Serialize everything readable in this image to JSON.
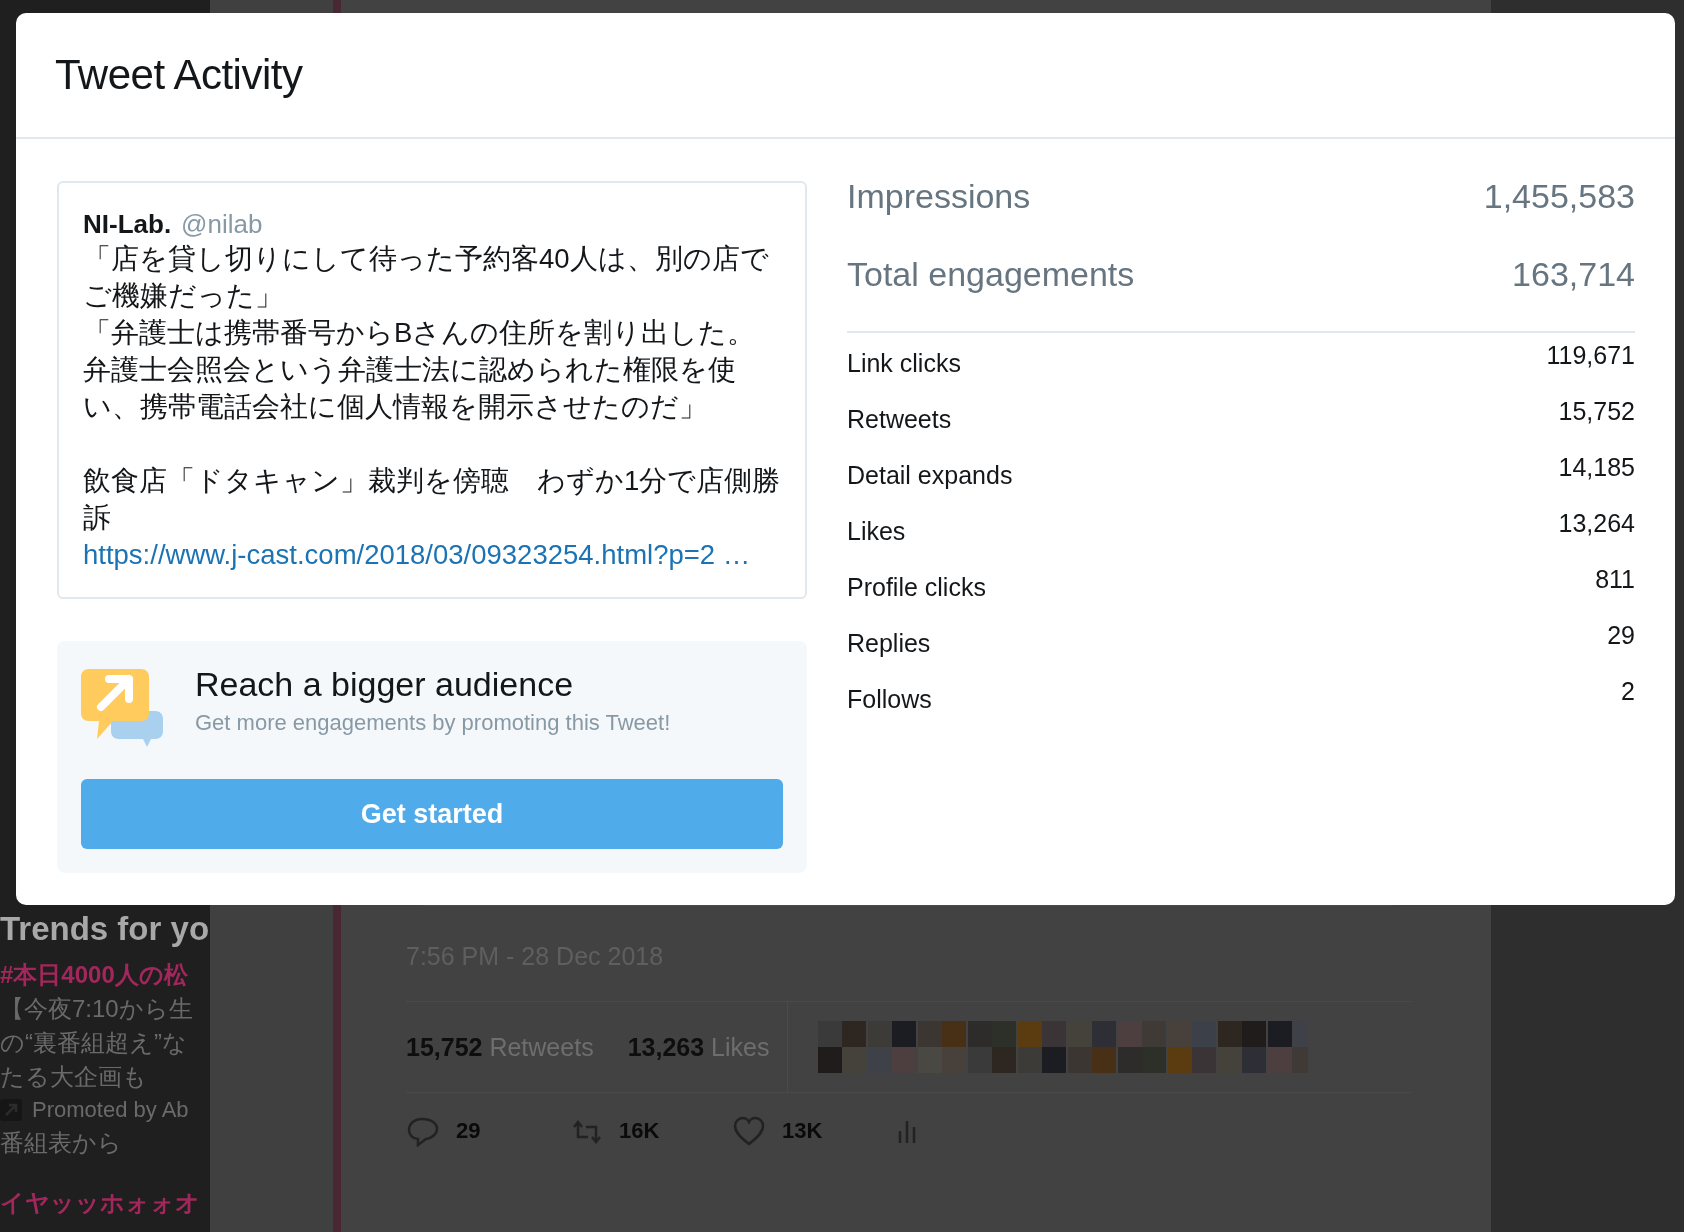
{
  "background": {
    "sidebar": {
      "trends_title": "Trends for yo",
      "trends": [
        {
          "name": "#本日4000人の松",
          "lines": [
            "【今夜7:10から生",
            "の“裏番組超え”な",
            "たる大企画も"
          ],
          "promoted": "Promoted by Ab",
          "note": "番組表から"
        },
        {
          "name": "イヤッッホォォオ"
        }
      ]
    },
    "tweet": {
      "timestamp": "7:56 PM - 28 Dec 2018",
      "counts": [
        "**15,752** Retweets",
        "**13,263** Likes"
      ],
      "actions": [
        {
          "kind": "reply",
          "count": "29"
        },
        {
          "kind": "retweet",
          "count": "16K"
        },
        {
          "kind": "like",
          "count": "13K"
        },
        {
          "kind": "analytics"
        }
      ]
    }
  },
  "modal": {
    "title": "Tweet Activity",
    "tweet": {
      "author": "NI-Lab.",
      "handle": "@nilab",
      "paragraphs": [
        "「店を貸し切りにして待った予約客40人は、別の店でご機嫌だった」",
        "「弁護士は携帯番号からBさんの住所を割り出した。弁護士会照会という弁護士法に認められた権限を使い、携帯電話会社に個人情報を開示させたのだ」"
      ],
      "headline": "飲食店「ドタキャン」裁判を傍聴　わずか1分で店側勝訴",
      "link": "https://www.j-cast.com/2018/03/09323254.html?p=2 …"
    },
    "promo": {
      "title": "Reach a bigger audience",
      "subtitle": "Get more engagements by promoting this Tweet!",
      "button": "Get started"
    },
    "summary": [
      {
        "label": "Impressions",
        "value": "1,455,583"
      },
      {
        "label": "Total engagements",
        "value": "163,714"
      }
    ],
    "engagements": [
      {
        "label": "Link clicks",
        "value": "119,671"
      },
      {
        "label": "Retweets",
        "value": "15,752"
      },
      {
        "label": "Detail expands",
        "value": "14,185"
      },
      {
        "label": "Likes",
        "value": "13,264"
      },
      {
        "label": "Profile clicks",
        "value": "811"
      },
      {
        "label": "Replies",
        "value": "29"
      },
      {
        "label": "Follows",
        "value": "2"
      }
    ]
  }
}
